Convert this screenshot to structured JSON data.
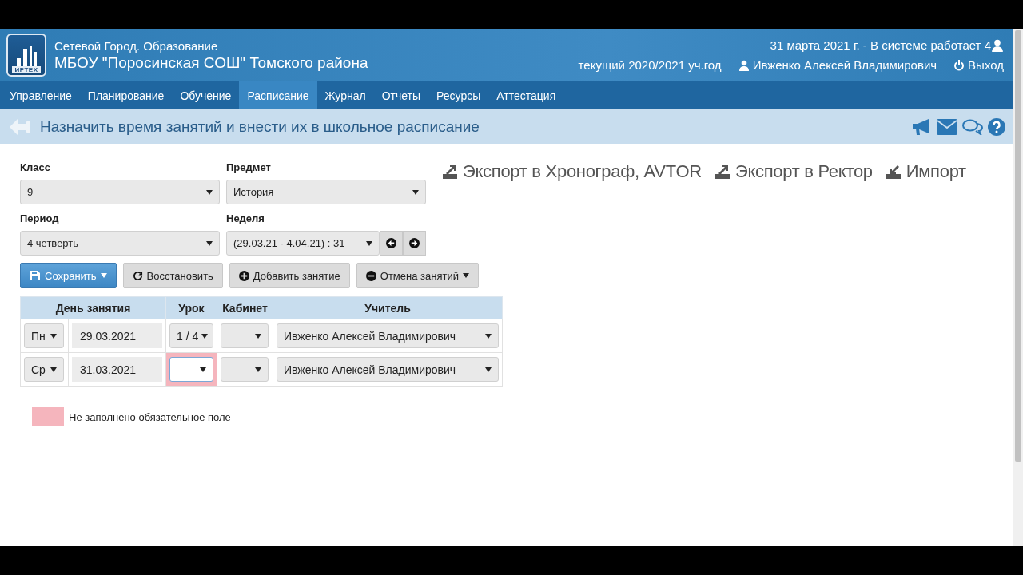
{
  "header": {
    "logo_text": "ИРТЕХ",
    "system": "Сетевой Город. Образование",
    "school": "МБОУ \"Поросинская СОШ\" Томского района",
    "status": "31 марта 2021 г. - В системе работает 4",
    "school_year": "текущий 2020/2021 уч.год",
    "user": "Ивженко Алексей Владимирович",
    "logout": "Выход"
  },
  "nav": [
    {
      "label": "Управление",
      "selected": false
    },
    {
      "label": "Планирование",
      "selected": false
    },
    {
      "label": "Обучение",
      "selected": false
    },
    {
      "label": "Расписание",
      "selected": true
    },
    {
      "label": "Журнал",
      "selected": false
    },
    {
      "label": "Отчеты",
      "selected": false
    },
    {
      "label": "Ресурсы",
      "selected": false
    },
    {
      "label": "Аттестация",
      "selected": false
    }
  ],
  "page_title": "Назначить время занятий и внести их в школьное расписание",
  "filters": [
    {
      "label": "Класс",
      "value": "9"
    },
    {
      "label": "Предмет",
      "value": "История"
    },
    {
      "label": "Период",
      "value": "4 четверть"
    },
    {
      "label": "Неделя",
      "value": "(29.03.21 - 4.04.21) : 31",
      "kind": "week"
    }
  ],
  "links": [
    {
      "label": "Экспорт в Хронограф, AVTOR",
      "kind": "export"
    },
    {
      "label": "Экспорт в Ректор",
      "kind": "export"
    },
    {
      "label": "Импорт",
      "kind": "import"
    }
  ],
  "actions": [
    {
      "label": "Сохранить",
      "kind": "save",
      "primary": true,
      "dropdown": true
    },
    {
      "label": "Восстановить",
      "kind": "restore",
      "primary": false,
      "dropdown": false
    },
    {
      "label": "Добавить занятие",
      "kind": "add",
      "primary": false,
      "dropdown": false
    },
    {
      "label": "Отмена занятий",
      "kind": "cancel",
      "primary": false,
      "dropdown": true
    }
  ],
  "table": {
    "columns": [
      "День занятия",
      "Урок",
      "Кабинет",
      "Учитель"
    ],
    "rows": [
      {
        "day": "Пн",
        "date": "29.03.2021",
        "lesson": "1 / 4",
        "lesson_missing": false,
        "teacher": "Ивженко Алексей Владимирович"
      },
      {
        "day": "Ср",
        "date": "31.03.2021",
        "lesson_missing": true,
        "teacher": "Ивженко Алексей Владимирович"
      }
    ]
  },
  "legend": "Не заполнено обязательное поле"
}
